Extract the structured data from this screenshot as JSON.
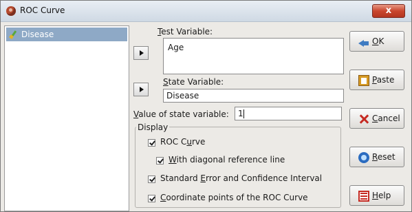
{
  "window": {
    "title": "ROC Curve",
    "close_glyph": "x"
  },
  "source_list": {
    "items": [
      {
        "label": "Disease",
        "icon": "scale-variable-icon"
      }
    ]
  },
  "test_variable": {
    "label_accesskey": "T",
    "label_rest": "est Variable:",
    "items": [
      "Age"
    ]
  },
  "state_variable": {
    "label_accesskey": "S",
    "label_rest": "tate Variable:",
    "value": "Disease"
  },
  "state_value": {
    "label_accesskey": "V",
    "label_rest": "alue of state variable:",
    "value": "1"
  },
  "display": {
    "title": "Display",
    "roc_curve": {
      "pre": "ROC C",
      "key": "u",
      "post": "rve",
      "checked": true
    },
    "diagonal": {
      "key": "W",
      "post": "ith diagonal reference line",
      "checked": true
    },
    "std_error": {
      "pre": "Standard ",
      "key": "E",
      "post": "rror and Confidence Interval",
      "checked": true
    },
    "coord_points": {
      "key": "C",
      "post": "oordinate points of the ROC Curve",
      "checked": true
    }
  },
  "buttons": {
    "ok": {
      "key": "O",
      "post": "K",
      "icon": "ok-arrow-icon"
    },
    "paste": {
      "key": "P",
      "post": "aste",
      "icon": "paste-icon"
    },
    "cancel": {
      "key": "C",
      "post": "ancel",
      "icon": "cancel-icon"
    },
    "reset": {
      "key": "R",
      "post": "eset",
      "icon": "reset-icon"
    },
    "help": {
      "key": "H",
      "post": "elp",
      "icon": "help-icon"
    }
  },
  "colors": {
    "selection": "#8ea9c6",
    "dialog_bg": "#eceae6",
    "close_red": "#c9462d"
  }
}
